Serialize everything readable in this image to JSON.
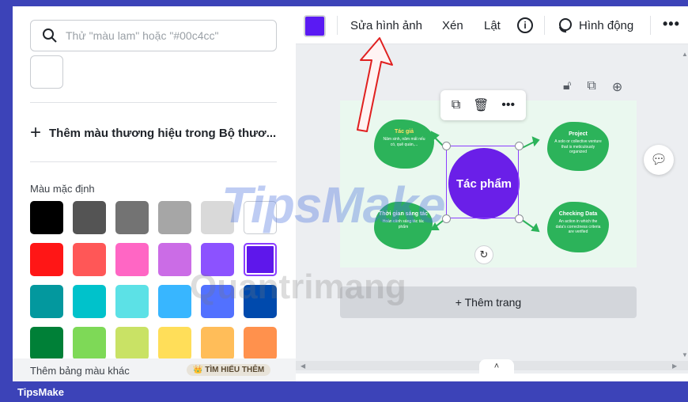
{
  "left_panel": {
    "search_placeholder": "Thử \"màu lam\" hoặc \"#00c4cc\"",
    "add_brand_label": "Thêm màu thương hiệu trong Bộ thươ...",
    "default_colors_title": "Màu mặc định",
    "more_palettes_label": "Thêm bảng màu khác",
    "learn_more_badge": "TÌM HIỂU THÊM",
    "swatch_colors": [
      [
        "#000000",
        "#545454",
        "#737373",
        "#a6a6a6",
        "#d9d9d9",
        "#ffffff"
      ],
      [
        "#ff1616",
        "#ff5757",
        "#ff66c4",
        "#cb6ce6",
        "#8c52ff",
        "#5e17eb"
      ],
      [
        "#03989e",
        "#00c2cb",
        "#5ce1e6",
        "#38b6ff",
        "#5271ff",
        "#004aad"
      ],
      [
        "#008037",
        "#7ed957",
        "#c9e265",
        "#ffde59",
        "#ffbd59",
        "#ff914d"
      ]
    ],
    "selected_swatch": "#5e17eb"
  },
  "toolbar": {
    "color": "#5a1af3",
    "edit_image_label": "Sửa hình ảnh",
    "crop_label": "Xén",
    "flip_label": "Lật",
    "info_label": "i",
    "animate_label": "Hình động",
    "more_label": "•••"
  },
  "floating_menu": {
    "copy_icon": "copy-icon",
    "delete_icon": "trash-icon",
    "more_label": "•••"
  },
  "canvas": {
    "center_text": "Tác phẩm",
    "bubbles": [
      {
        "title": "Tác giả",
        "text": "Năm sinh, năm mất nếu có, quê quán,..."
      },
      {
        "title": "Project",
        "text": "A solo or collective venture that is meticulously organized"
      },
      {
        "title": "Thời gian sáng tác",
        "text": "Hoàn cảnh sáng tác tác phẩm"
      },
      {
        "title": "Checking Data",
        "text": "An action in which the data's correctness criteria are verified"
      }
    ]
  },
  "add_page_label": "+ Thêm trang",
  "watermark": {
    "brand_top": "TipsMake",
    "brand_mid": "uantrimang"
  },
  "footer": {
    "label": "TipsMake"
  }
}
